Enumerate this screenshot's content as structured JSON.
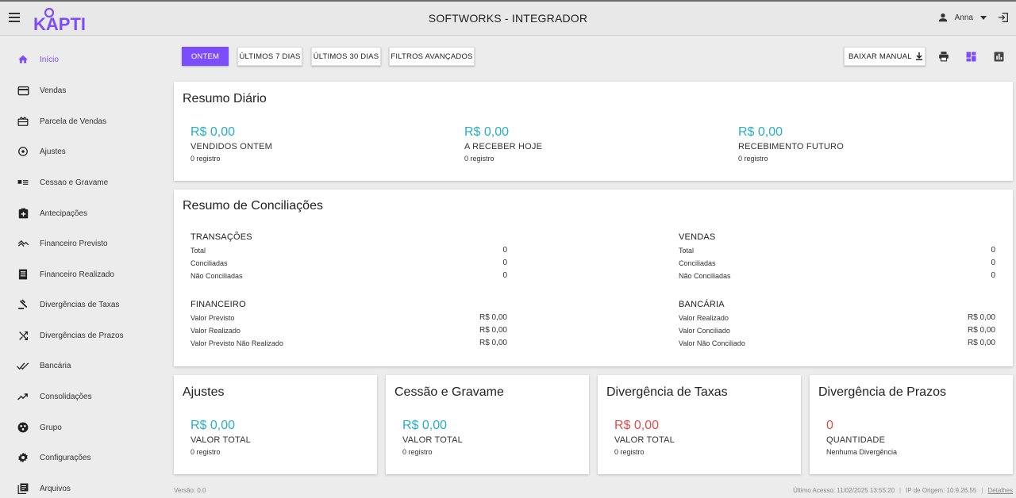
{
  "header": {
    "title": "SOFTWORKS - INTEGRADOR",
    "logo_text": "KAPTI",
    "user_name": "Anna"
  },
  "sidebar": {
    "items": [
      {
        "label": "Início",
        "icon": "home-icon",
        "active": true
      },
      {
        "label": "Vendas",
        "icon": "credit-card-icon"
      },
      {
        "label": "Parcela de Vendas",
        "icon": "card-giftcard-icon"
      },
      {
        "label": "Ajustes",
        "icon": "adjust-icon"
      },
      {
        "label": "Cessao e Gravame",
        "icon": "id-card-icon"
      },
      {
        "label": "Antecipações",
        "icon": "add-box-icon"
      },
      {
        "label": "Financeiro Previsto",
        "icon": "trending-icon"
      },
      {
        "label": "Financeiro Realizado",
        "icon": "list-alt-icon"
      },
      {
        "label": "Divergências de Taxas",
        "icon": "gavel-icon"
      },
      {
        "label": "Divergências de Prazos",
        "icon": "shuffle-icon"
      },
      {
        "label": "Bancária",
        "icon": "done-all-icon"
      },
      {
        "label": "Consolidações",
        "icon": "trending-up-icon"
      },
      {
        "label": "Grupo",
        "icon": "group-icon"
      },
      {
        "label": "Configurações",
        "icon": "settings-icon"
      },
      {
        "label": "Arquivos",
        "icon": "library-books-icon"
      }
    ]
  },
  "toolbar": {
    "ontem": "ONTEM",
    "ultimos7": "ÚLTIMOS 7 DIAS",
    "ultimos30": "ÚLTIMOS 30 DIAS",
    "filtros": "FILTROS AVANÇADOS",
    "baixar": "BAIXAR MANUAL"
  },
  "resumo_diario": {
    "title": "Resumo Diário",
    "metrics": [
      {
        "value": "R$ 0,00",
        "label": "VENDIDOS ONTEM",
        "sub": "0 registro"
      },
      {
        "value": "R$ 0,00",
        "label": "A RECEBER HOJE",
        "sub": "0 registro"
      },
      {
        "value": "R$ 0,00",
        "label": "RECEBIMENTO FUTURO",
        "sub": "0 registro"
      }
    ]
  },
  "conciliacoes": {
    "title": "Resumo de Conciliações",
    "transacoes": {
      "title": "TRANSAÇÕES",
      "rows": [
        {
          "label": "Total",
          "value": "0"
        },
        {
          "label": "Conciliadas",
          "value": "0"
        },
        {
          "label": "Não Conciliadas",
          "value": "0"
        }
      ]
    },
    "vendas": {
      "title": "VENDAS",
      "rows": [
        {
          "label": "Total",
          "value": "0"
        },
        {
          "label": "Conciliadas",
          "value": "0"
        },
        {
          "label": "Não Conciliadas",
          "value": "0"
        }
      ]
    },
    "financeiro": {
      "title": "FINANCEIRO",
      "rows": [
        {
          "label": "Valor Previsto",
          "value": "R$ 0,00"
        },
        {
          "label": "Valor Realizado",
          "value": "R$ 0,00"
        },
        {
          "label": "Valor Previsto Não Realizado",
          "value": "R$ 0,00"
        }
      ]
    },
    "bancaria": {
      "title": "BANCÁRIA",
      "rows": [
        {
          "label": "Valor Realizado",
          "value": "R$ 0,00"
        },
        {
          "label": "Valor Conciliado",
          "value": "R$ 0,00"
        },
        {
          "label": "Valor Não Conciliado",
          "value": "R$ 0,00"
        }
      ]
    }
  },
  "bottom_cards": [
    {
      "title": "Ajustes",
      "value": "R$ 0,00",
      "label": "VALOR TOTAL",
      "sub": "0 registro",
      "value_color": "#26aec6"
    },
    {
      "title": "Cessão e Gravame",
      "value": "R$ 0,00",
      "label": "VALOR TOTAL",
      "sub": "0 registro",
      "value_color": "#26aec6"
    },
    {
      "title": "Divergência de Taxas",
      "value": "R$ 0,00",
      "label": "VALOR TOTAL",
      "sub": "0 registro",
      "value_color": "#e04b4b"
    },
    {
      "title": "Divergência de Prazos",
      "value": "0",
      "label": "QUANTIDADE",
      "sub": "Nenhuma Divergência",
      "value_color": "#e04b4b"
    }
  ],
  "footer": {
    "version": "Versão: 0.0",
    "last_access": "Último Acesso: 11/02/2025 13:55:20",
    "ip": "IP de Origem: 10.9.26.55",
    "details": "Detalhes"
  },
  "colors": {
    "accent": "#7c4dff",
    "value_teal": "#26aec6",
    "value_red": "#e04b4b"
  }
}
